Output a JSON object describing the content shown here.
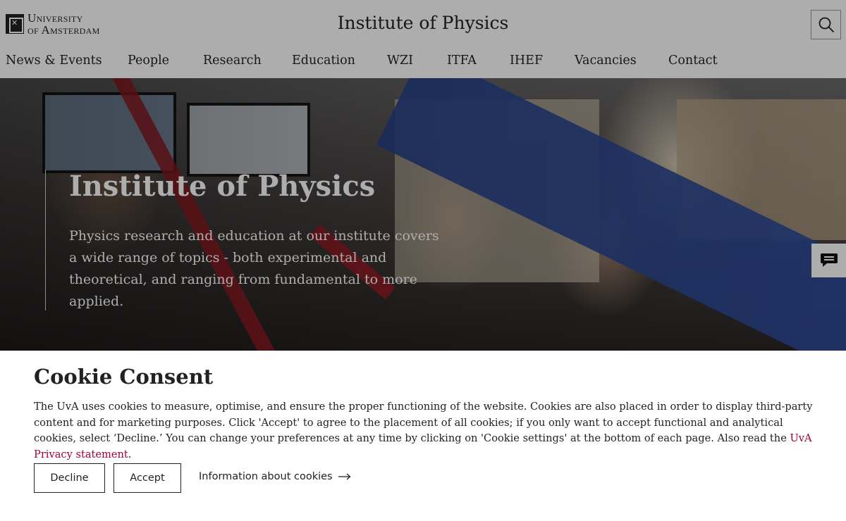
{
  "header": {
    "logo_line1": "University",
    "logo_line2": "of Amsterdam",
    "site_title": "Institute of Physics",
    "search_icon": "search-icon"
  },
  "nav": {
    "items": [
      {
        "label": "News & Events"
      },
      {
        "label": "People"
      },
      {
        "label": "Research"
      },
      {
        "label": "Education"
      },
      {
        "label": "WZI"
      },
      {
        "label": "ITFA"
      },
      {
        "label": "IHEF"
      },
      {
        "label": "Vacancies"
      },
      {
        "label": "Contact"
      }
    ]
  },
  "hero": {
    "title": "Institute of Physics",
    "text": "Physics research and education at our institute covers a wide range of topics - both experimental and theoretical, and ranging from fundamental to more applied."
  },
  "chat": {
    "icon": "chat-icon"
  },
  "cookie": {
    "title": "Cookie Consent",
    "text": "The UvA uses cookies to measure, optimise, and ensure the proper functioning of the website. Cookies are also placed in order to display third-party content and for marketing purposes. Click 'Accept' to agree to the placement of all cookies; if you only want to accept functional and analytical cookies, select ‘Decline.’ You can change your preferences at any time by clicking on 'Cookie settings' at the bottom of each page. Also read the ",
    "privacy_link": "UvA Privacy statement",
    "text_end": ".",
    "decline_label": "Decline",
    "accept_label": "Accept",
    "info_label": "Information about cookies",
    "accent_color": "#a0003c"
  }
}
